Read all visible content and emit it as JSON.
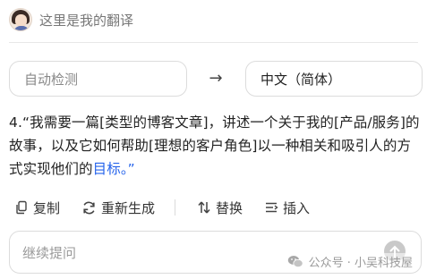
{
  "header": {
    "title": "这里是我的翻译"
  },
  "language": {
    "source": "自动检测",
    "arrow": "→",
    "target": "中文（简体）"
  },
  "result": {
    "text_main": "4.“我需要一篇[类型的博客文章]，讲述一个关于我的[产品/服务]的故事，以及它如何帮助[理想的客户角色]以一种相关和吸引人的方式实现他们的",
    "link_text": "目标",
    "text_end": "。”"
  },
  "actions": {
    "copy": "复制",
    "regenerate": "重新生成",
    "replace": "替换",
    "insert": "插入"
  },
  "followup": {
    "placeholder": "继续提问"
  },
  "watermark": {
    "text": "公众号 · 小吴科技屋"
  },
  "icons": {
    "copy": "copy-icon",
    "regenerate": "refresh-icon",
    "replace": "swap-icon",
    "insert": "insert-icon",
    "send": "arrow-up-icon",
    "wechat": "wechat-icon"
  },
  "colors": {
    "link": "#2563eb",
    "border": "#dcdcdc"
  }
}
